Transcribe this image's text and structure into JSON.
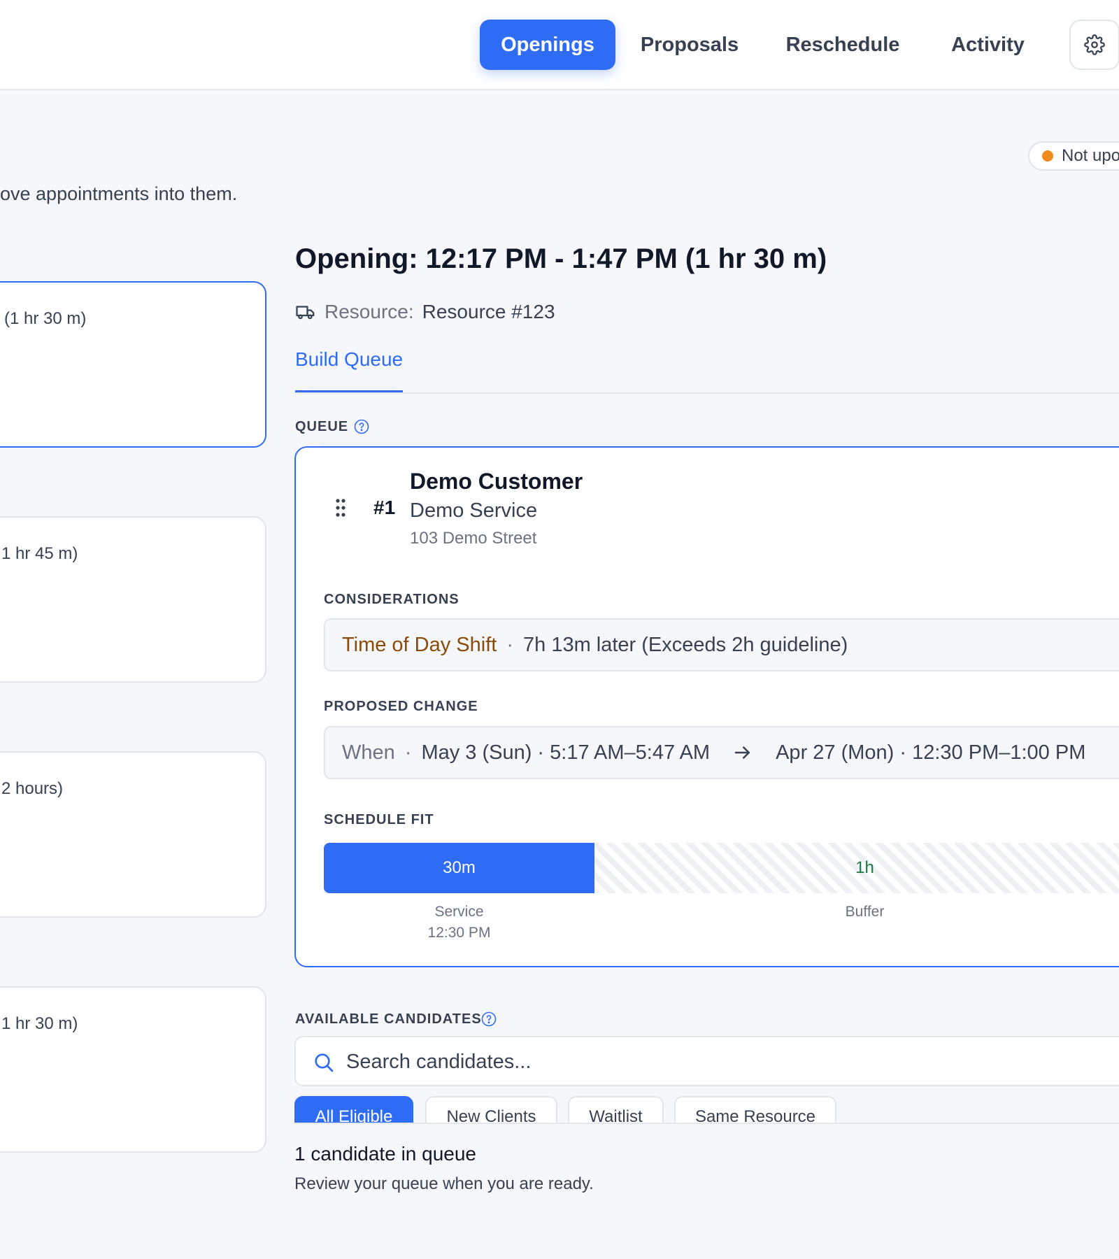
{
  "nav": {
    "tabs": [
      {
        "label": "Openings",
        "active": true
      },
      {
        "label": "Proposals",
        "active": false
      },
      {
        "label": "Reschedule",
        "active": false
      },
      {
        "label": "Activity",
        "active": false
      }
    ],
    "settings_icon": "gear-icon"
  },
  "status": {
    "label": "Not upo",
    "dot_color": "#f08a1c"
  },
  "page": {
    "subtitle": "ove appointments into them."
  },
  "openings_list": [
    {
      "duration": "(1 hr 30 m)",
      "selected": true
    },
    {
      "duration": "1 hr 45 m)",
      "selected": false
    },
    {
      "duration": "2 hours)",
      "selected": false
    },
    {
      "duration": "1 hr 30 m)",
      "selected": false
    }
  ],
  "detail": {
    "title": "Opening: 12:17 PM - 1:47 PM (1 hr 30 m)",
    "resource_icon": "truck-icon",
    "resource_label": "Resource:",
    "resource_value": "Resource #123",
    "tab": "Build Queue"
  },
  "queue": {
    "section_label": "QUEUE",
    "help_icon": "question-circle-icon",
    "item": {
      "rank": "#1",
      "customer": "Demo Customer",
      "service": "Demo Service",
      "address": "103 Demo Street"
    },
    "considerations_label": "CONSIDERATIONS",
    "consideration": {
      "type": "Time of Day Shift",
      "separator": "·",
      "detail": "7h 13m later (Exceeds 2h guideline)"
    },
    "proposed_change_label": "PROPOSED CHANGE",
    "proposed_change": {
      "field": "When",
      "separator": "·",
      "from": "May 3 (Sun) · 5:17 AM–5:47 AM",
      "to": "Apr 27 (Mon) · 12:30 PM–1:00 PM"
    },
    "schedule_fit_label": "SCHEDULE FIT",
    "schedule_fit": {
      "service_label": "30m",
      "service_fraction": 0.3333,
      "buffer_label": "1h",
      "service_caption": "Service",
      "service_time": "12:30 PM",
      "buffer_caption": "Buffer",
      "service_color": "#2f6cf6"
    }
  },
  "candidates": {
    "section_label": "AVAILABLE CANDIDATES",
    "search_placeholder": "Search candidates...",
    "filters": [
      {
        "label": "All Eligible",
        "active": true
      },
      {
        "label": "New Clients",
        "active": false
      },
      {
        "label": "Waitlist",
        "active": false
      },
      {
        "label": "Same Resource",
        "active": false
      }
    ],
    "count_text": "1 candidate in queue",
    "hint_text": "Review your queue when you are ready."
  },
  "colors": {
    "accent": "#2f6cf6",
    "warning_text": "#8a4b07",
    "buffer_text": "#1b7a43"
  }
}
